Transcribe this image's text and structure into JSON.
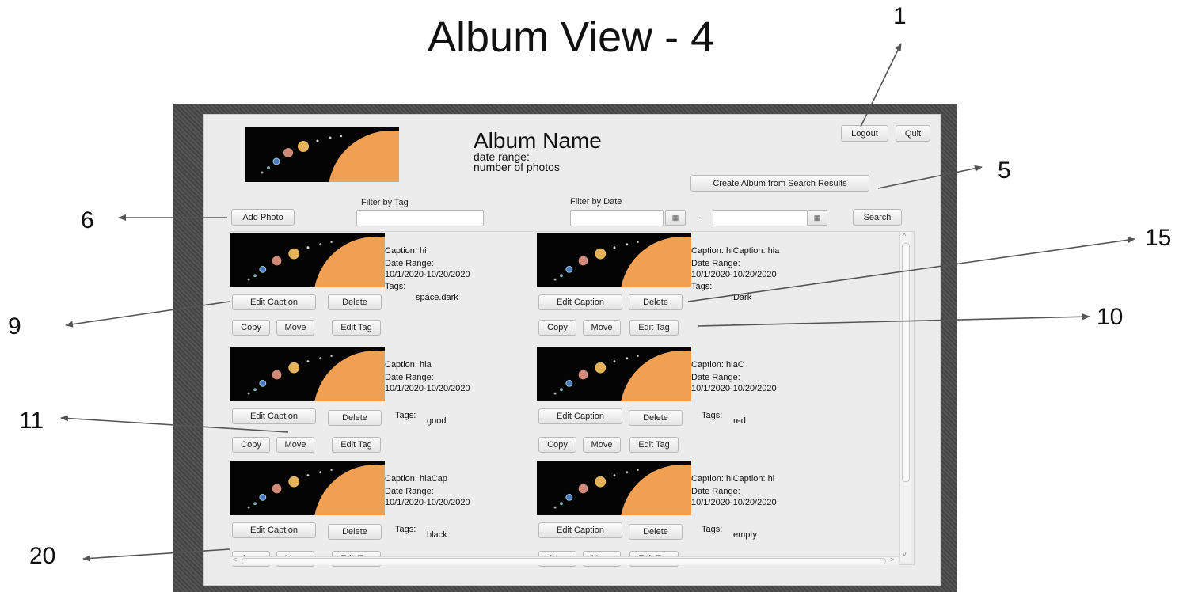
{
  "slide": {
    "title": "Album View - 4"
  },
  "callouts": {
    "c1": "1",
    "c5": "5",
    "c6": "6",
    "c9": "9",
    "c10": "10",
    "c11": "11",
    "c15": "15",
    "c20": "20"
  },
  "album": {
    "name": "Album Name",
    "date_range_label": "date range:",
    "photo_count_label": "number of photos"
  },
  "buttons": {
    "logout": "Logout",
    "quit": "Quit",
    "create_album": "Create Album from Search Results",
    "add_photo": "Add Photo",
    "search": "Search"
  },
  "filters": {
    "tag_label": "Filter by Tag",
    "date_label": "Filter by Date",
    "tag_value": "",
    "date_from": "",
    "date_to": "",
    "dash": "-",
    "calendar_icon": "calendar-icon"
  },
  "card_buttons": {
    "edit_caption": "Edit Caption",
    "delete": "Delete",
    "copy": "Copy",
    "move": "Move",
    "edit_tag": "Edit Tag"
  },
  "photos": [
    {
      "caption": "Caption: hi",
      "date_label": "Date Range:",
      "date_value": "10/1/2020-10/20/2020",
      "tags_label": "Tags:",
      "tags": "space.dark"
    },
    {
      "caption": "Caption: hiCaption: hia",
      "date_label": "Date Range:",
      "date_value": "10/1/2020-10/20/2020",
      "tags_label": "Tags:",
      "tags": "Dark"
    },
    {
      "caption": "Caption: hia",
      "date_label": "Date Range:",
      "date_value": "10/1/2020-10/20/2020",
      "tags_label": "Tags:",
      "tags": "good"
    },
    {
      "caption": "Caption: hiaC",
      "date_label": "Date Range:",
      "date_value": "10/1/2020-10/20/2020",
      "tags_label": "Tags:",
      "tags": "red"
    },
    {
      "caption": "Caption: hiaCap",
      "date_label": "Date Range:",
      "date_value": "10/1/2020-10/20/2020",
      "tags_label": "Tags:",
      "tags": "black"
    },
    {
      "caption": "Caption: hiCaption: hi",
      "date_label": "Date Range:",
      "date_value": "10/1/2020-10/20/2020",
      "tags_label": "Tags:",
      "tags": "empty"
    }
  ],
  "colors": {
    "window_bg": "#4a4a4a",
    "panel_bg": "#ececec",
    "sun": "#f0a050"
  }
}
